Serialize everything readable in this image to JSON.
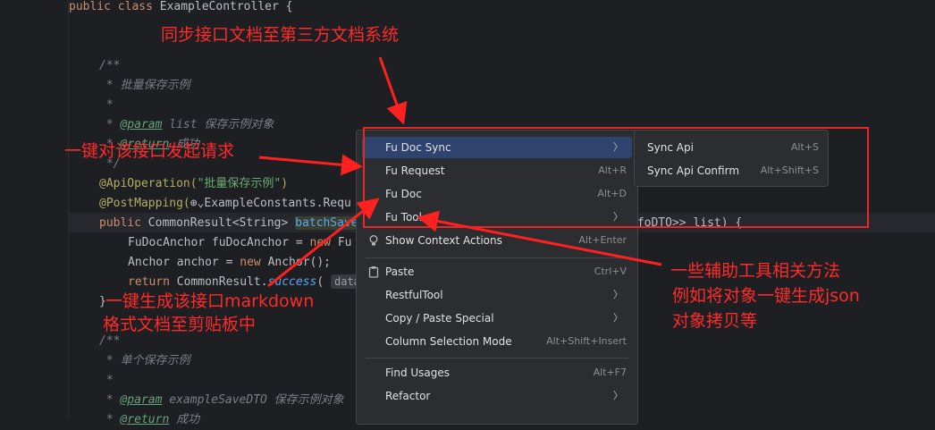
{
  "code": {
    "l1_kw": "public class ",
    "l1_rest": "ExampleController {",
    "l2": "/**",
    "l3": " * 批量保存示例",
    "l4": " *",
    "l5_star": " * ",
    "l5_tag": "@param",
    "l5_rest": " list 保存示例对象",
    "l6_star": " * ",
    "l6_tag": "@return",
    "l6_rest": " 成功",
    "l7": " */",
    "l8_ann": "@ApiOperation(",
    "l8_str": "\"批量保存示例\"",
    "l8_end": ")",
    "l9_ann": "@PostMapping(",
    "l9_icon": "⊕⌄",
    "l9_rest": "ExampleConstants.Requ",
    "l10_kw": "public ",
    "l10_type": "CommonResult<String> ",
    "l10_fn": "batchSave",
    "l10_tail": "nfoDTO>> list) {",
    "l11_type": "FuDocAnchor ",
    "l11_var": "fuDocAnchor",
    "l11_rest": " = ",
    "l11_kw": "new ",
    "l11_tail": "Fu",
    "l12_type": "Anchor ",
    "l12_var": "anchor",
    "l12_rest": " = ",
    "l12_kw": "new ",
    "l12_tail": "Anchor();",
    "l13_kw": "return ",
    "l13_rest": "CommonResult.",
    "l13_fn": "success",
    "l13_paren": "( ",
    "l13_hint": "data",
    "l14": "}",
    "l15": "/**",
    "l16": " * 单个保存示例",
    "l17": " *",
    "l18_star": " * ",
    "l18_tag": "@param",
    "l18_rest": " exampleSaveDTO 保存示例对象",
    "l19_star": " * ",
    "l19_tag": "@return",
    "l19_rest": " 成功"
  },
  "menu": {
    "items": [
      {
        "label": "Fu Doc Sync",
        "shortcut": "",
        "submenu": true
      },
      {
        "label": "Fu Request",
        "shortcut": "Alt+R"
      },
      {
        "label": "Fu Doc",
        "shortcut": "Alt+D"
      },
      {
        "label": "Fu Tool",
        "shortcut": "",
        "submenu": true
      },
      {
        "label": "Show Context Actions",
        "shortcut": "Alt+Enter"
      },
      {
        "label": "Paste",
        "shortcut": "Ctrl+V"
      },
      {
        "label": "RestfulTool",
        "shortcut": "",
        "submenu": true
      },
      {
        "label": "Copy / Paste Special",
        "shortcut": "",
        "submenu": true
      },
      {
        "label": "Column Selection Mode",
        "shortcut": "Alt+Shift+Insert"
      },
      {
        "label": "Find Usages",
        "shortcut": "Alt+F7"
      },
      {
        "label": "Refactor",
        "shortcut": "",
        "submenu": true
      }
    ],
    "arrow": "〉"
  },
  "submenu": {
    "items": [
      {
        "label": "Sync Api",
        "shortcut": "Alt+S"
      },
      {
        "label": "Sync Api Confirm",
        "shortcut": "Alt+Shift+S"
      }
    ]
  },
  "annotations": {
    "sync": "同步接口文档至第三方文档系统",
    "request": "一键对该接口发起请求",
    "markdown_1": "一键生成该接口markdown",
    "markdown_2": "格式文档至剪贴板中",
    "tool_1": "一些辅助工具相关方法",
    "tool_2": "例如将对象一键生成json",
    "tool_3": "对象拷贝等"
  },
  "colors": {
    "accent_red": "#e82828",
    "menu_selected": "#2e436e",
    "editor_bg": "#1e1f22"
  }
}
